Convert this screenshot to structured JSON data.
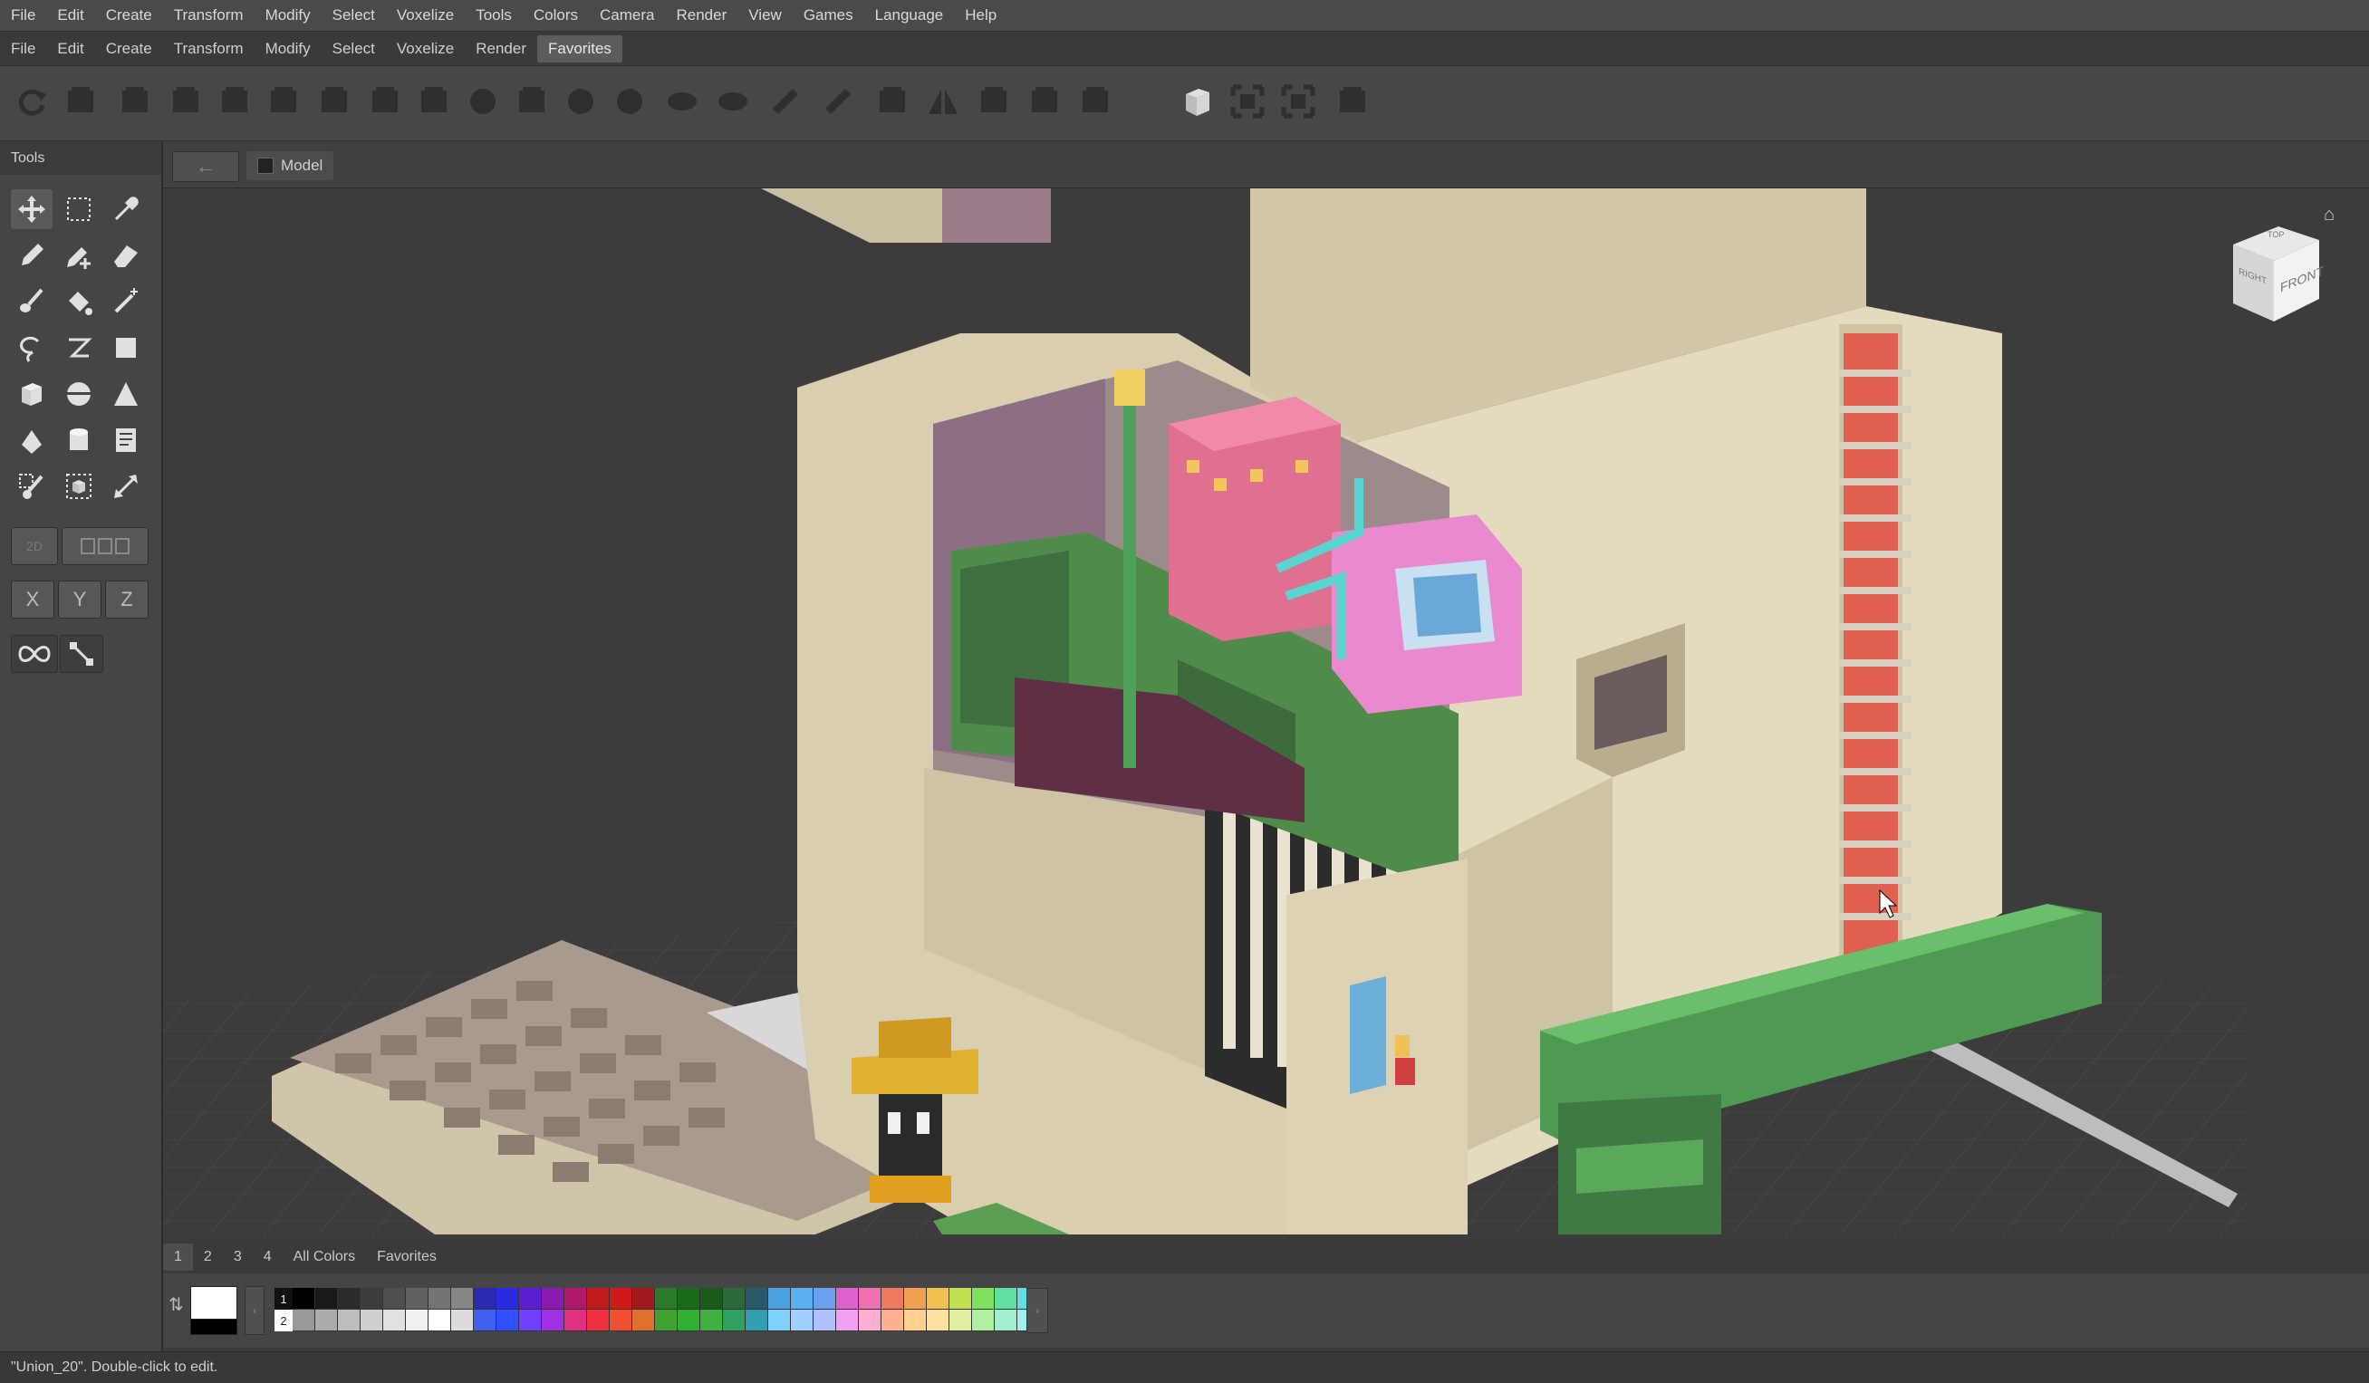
{
  "menu_primary": [
    "File",
    "Edit",
    "Create",
    "Transform",
    "Modify",
    "Select",
    "Voxelize",
    "Tools",
    "Colors",
    "Camera",
    "Render",
    "View",
    "Games",
    "Language",
    "Help"
  ],
  "menu_secondary": [
    "File",
    "Edit",
    "Create",
    "Transform",
    "Modify",
    "Select",
    "Voxelize",
    "Render",
    "Favorites"
  ],
  "menu_secondary_active": "Favorites",
  "tools_panel": {
    "title": "Tools",
    "axis_buttons": [
      "X",
      "Y",
      "Z"
    ],
    "tool_icons": [
      "move-icon",
      "marquee-select-icon",
      "eyedropper-icon",
      "pencil-icon",
      "pencil-plus-icon",
      "eraser-icon",
      "paint-brush-icon",
      "paint-bucket-icon",
      "magic-wand-icon",
      "lasso-icon",
      "polyline-icon",
      "rectangle-icon",
      "cube-icon",
      "sphere-icon",
      "cone-icon",
      "triangle-icon",
      "cylinder-icon",
      "text-tool-icon",
      "brush-select-icon",
      "box-select-icon",
      "scale-arrows-icon"
    ]
  },
  "viewport": {
    "tab_label": "Model",
    "nav_cube": {
      "top": "TOP",
      "right": "RIGHT",
      "front": "FRONT"
    }
  },
  "palette": {
    "tabs": [
      "1",
      "2",
      "3",
      "4",
      "All Colors",
      "Favorites"
    ],
    "active_tab": "1",
    "row_labels": [
      "1",
      "2"
    ],
    "primary_color": "#ffffff",
    "secondary_color": "#000000",
    "row1": [
      "#000000",
      "#1a1a1a",
      "#2b2b2b",
      "#3d3d3d",
      "#4f4f4f",
      "#616161",
      "#747474",
      "#878787",
      "#2a2ab0",
      "#2a2ae0",
      "#5a20d0",
      "#8a1ab0",
      "#b01a6a",
      "#c01a1a",
      "#d01a1a",
      "#a01a1a",
      "#2a7a2a",
      "#1a6a1a",
      "#1a5a1a",
      "#2a6a3a",
      "#2a5a6a",
      "#4aa0e0",
      "#5ab0f0",
      "#6aa0f0",
      "#e060d0",
      "#f070b0",
      "#f07a60",
      "#f0a050",
      "#f0c050",
      "#c0e050",
      "#80e060",
      "#60e0a0",
      "#60e0e0"
    ],
    "row2": [
      "#999999",
      "#ababab",
      "#bdbdbd",
      "#cfcfcf",
      "#e1e1e1",
      "#f0f0f0",
      "#ffffff",
      "#dcdcdc",
      "#4060f0",
      "#3050ff",
      "#7040ff",
      "#a030e0",
      "#e03080",
      "#f03040",
      "#f05030",
      "#e07030",
      "#40a030",
      "#30b030",
      "#40b040",
      "#30a060",
      "#30a0b0",
      "#80d0ff",
      "#a0d0ff",
      "#b0c0ff",
      "#f0a0f0",
      "#ffb0d0",
      "#ffb090",
      "#ffd090",
      "#ffe0a0",
      "#e0f0a0",
      "#b0f0a0",
      "#a0f0d0",
      "#a0f0f0"
    ]
  },
  "status": "\"Union_20\". Double-click to edit.",
  "colors": {
    "accent": "#5c5c5c",
    "background": "#3c3c3c",
    "cream_voxel": "#d9ceb0",
    "green_voxel": "#4a8a4a",
    "red_ladder": "#e06050"
  }
}
